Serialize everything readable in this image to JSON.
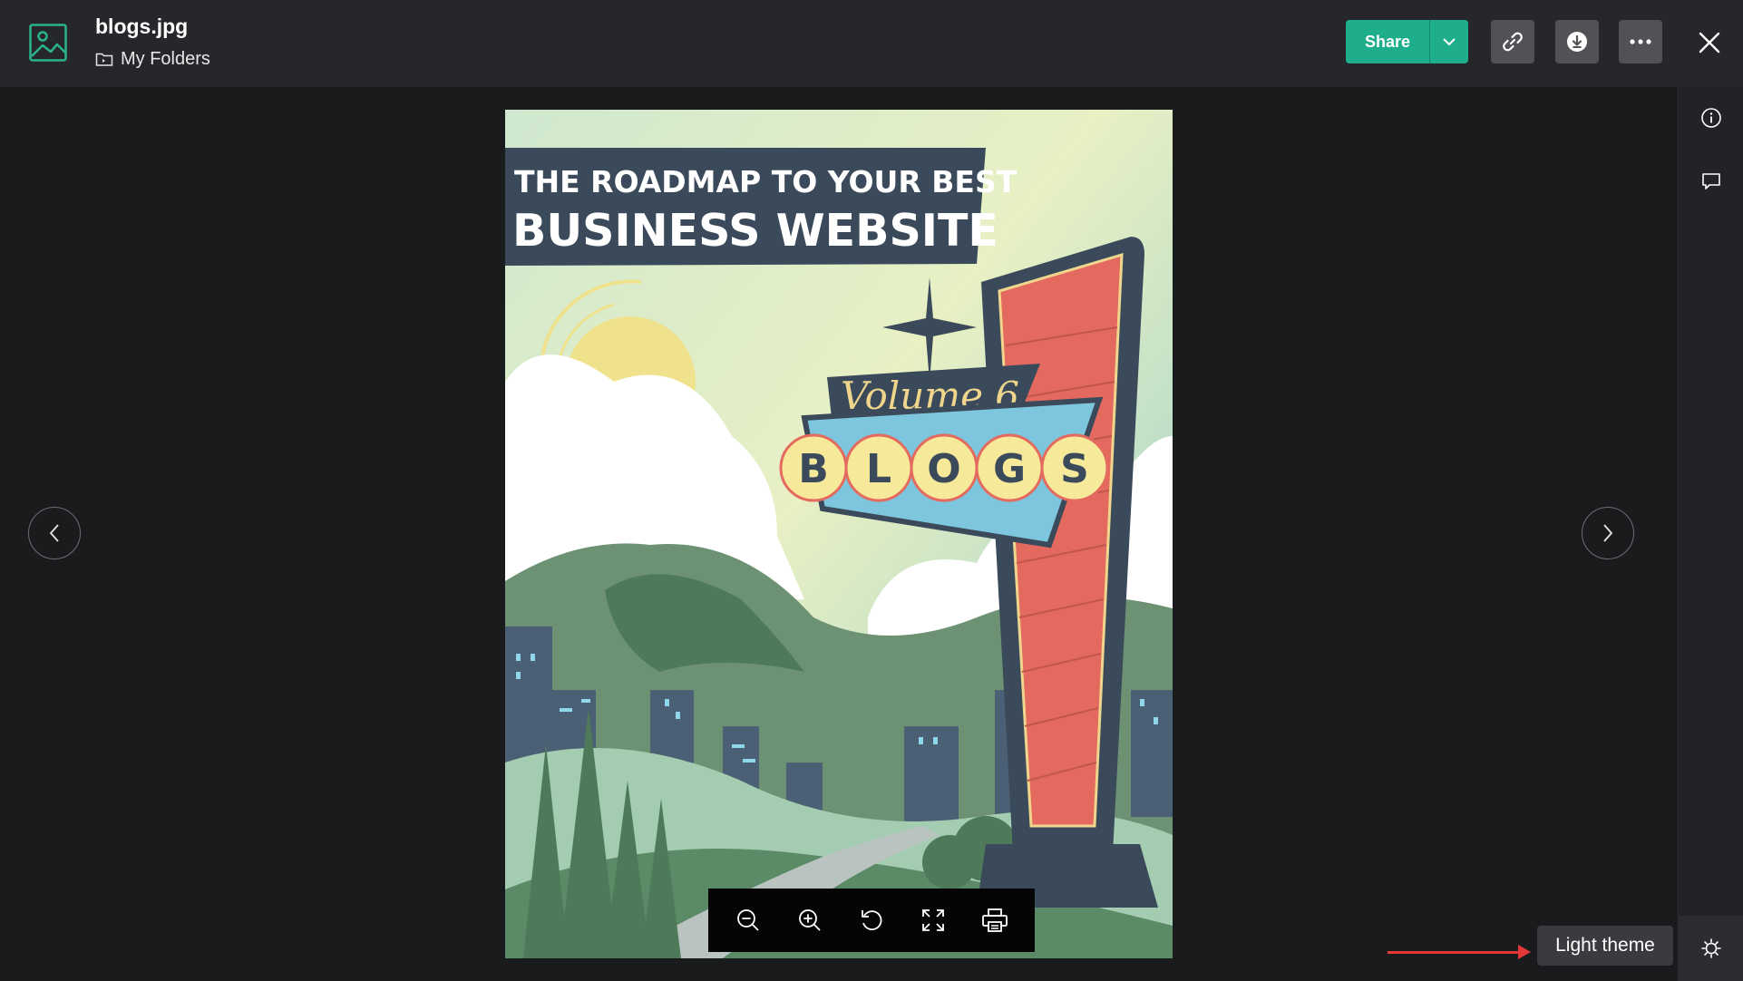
{
  "header": {
    "file_name": "blogs.jpg",
    "folder_name": "My Folders",
    "share_label": "Share"
  },
  "tooltip": {
    "label": "Light theme"
  },
  "poster": {
    "title_line1": "THE ROADMAP TO YOUR BEST",
    "title_line2": "BUSINESS WEBSITE",
    "volume": "Volume 6",
    "letters": [
      "B",
      "L",
      "O",
      "G",
      "S"
    ]
  },
  "icons": {
    "file": "image-file-icon",
    "folder": "folder-icon",
    "share_dropdown": "chevron-down-icon",
    "copy_link": "link-icon",
    "download": "download-icon",
    "more": "more-icon",
    "close": "close-icon",
    "info": "info-icon",
    "comment": "comment-icon",
    "theme": "sun-icon",
    "prev": "chevron-left-icon",
    "next": "chevron-right-icon",
    "zoom_out": "zoom-out-icon",
    "zoom_in": "zoom-in-icon",
    "rotate": "rotate-icon",
    "fullscreen": "fullscreen-icon",
    "print": "print-icon"
  },
  "colors": {
    "accent": "#1fae8c",
    "header_bg": "#26272a",
    "page_bg": "#1a1b1d",
    "arrow": "#e23838"
  }
}
